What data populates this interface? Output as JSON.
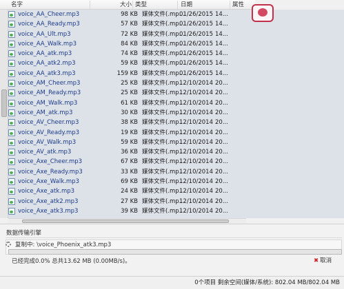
{
  "columns": {
    "name": "名字",
    "size": "大小",
    "type": "类型",
    "date": "日期",
    "attr": "属性"
  },
  "files": [
    {
      "name": "voice_AA_Cheer.mp3",
      "size": "98 KB",
      "type": "媒体文件(.mp...",
      "date": "01/26/2015",
      "ext": "14..."
    },
    {
      "name": "voice_AA_Ready.mp3",
      "size": "57 KB",
      "type": "媒体文件(.mp...",
      "date": "01/26/2015",
      "ext": "14..."
    },
    {
      "name": "voice_AA_Ult.mp3",
      "size": "72 KB",
      "type": "媒体文件(.mp...",
      "date": "01/26/2015",
      "ext": "14..."
    },
    {
      "name": "voice_AA_Walk.mp3",
      "size": "84 KB",
      "type": "媒体文件(.mp...",
      "date": "01/26/2015",
      "ext": "14..."
    },
    {
      "name": "voice_AA_atk.mp3",
      "size": "74 KB",
      "type": "媒体文件(.mp...",
      "date": "01/26/2015",
      "ext": "14..."
    },
    {
      "name": "voice_AA_atk2.mp3",
      "size": "59 KB",
      "type": "媒体文件(.mp...",
      "date": "01/26/2015",
      "ext": "14..."
    },
    {
      "name": "voice_AA_atk3.mp3",
      "size": "159 KB",
      "type": "媒体文件(.mp...",
      "date": "01/26/2015",
      "ext": "14..."
    },
    {
      "name": "voice_AM_Cheer.mp3",
      "size": "25 KB",
      "type": "媒体文件(.mp...",
      "date": "12/10/2014",
      "ext": "20..."
    },
    {
      "name": "voice_AM_Ready.mp3",
      "size": "25 KB",
      "type": "媒体文件(.mp...",
      "date": "12/10/2014",
      "ext": "20..."
    },
    {
      "name": "voice_AM_Walk.mp3",
      "size": "61 KB",
      "type": "媒体文件(.mp...",
      "date": "12/10/2014",
      "ext": "20..."
    },
    {
      "name": "voice_AM_atk.mp3",
      "size": "30 KB",
      "type": "媒体文件(.mp...",
      "date": "12/10/2014",
      "ext": "20..."
    },
    {
      "name": "voice_AV_Cheer.mp3",
      "size": "38 KB",
      "type": "媒体文件(.mp...",
      "date": "12/10/2014",
      "ext": "20..."
    },
    {
      "name": "voice_AV_Ready.mp3",
      "size": "19 KB",
      "type": "媒体文件(.mp...",
      "date": "12/10/2014",
      "ext": "20..."
    },
    {
      "name": "voice_AV_Walk.mp3",
      "size": "59 KB",
      "type": "媒体文件(.mp...",
      "date": "12/10/2014",
      "ext": "20..."
    },
    {
      "name": "voice_AV_atk.mp3",
      "size": "36 KB",
      "type": "媒体文件(.mp...",
      "date": "12/10/2014",
      "ext": "20..."
    },
    {
      "name": "voice_Axe_Cheer.mp3",
      "size": "67 KB",
      "type": "媒体文件(.mp...",
      "date": "12/10/2014",
      "ext": "20..."
    },
    {
      "name": "voice_Axe_Ready.mp3",
      "size": "33 KB",
      "type": "媒体文件(.mp...",
      "date": "12/10/2014",
      "ext": "20..."
    },
    {
      "name": "voice_Axe_Walk.mp3",
      "size": "69 KB",
      "type": "媒体文件(.mp...",
      "date": "12/10/2014",
      "ext": "20..."
    },
    {
      "name": "voice_Axe_atk.mp3",
      "size": "24 KB",
      "type": "媒体文件(.mp...",
      "date": "12/10/2014",
      "ext": "20..."
    },
    {
      "name": "voice_Axe_atk2.mp3",
      "size": "27 KB",
      "type": "媒体文件(.mp...",
      "date": "12/10/2014",
      "ext": "20..."
    },
    {
      "name": "voice_Axe_atk3.mp3",
      "size": "39 KB",
      "type": "媒体文件(.mp...",
      "date": "12/10/2014",
      "ext": "20..."
    }
  ],
  "transfer": {
    "section_label": "数据传输引擎",
    "copying_text": "复制中: \\voice_Phoenix_atk3.mp3",
    "progress_fraction": 0.0,
    "progress_text": "已经完成0.0% 总共13.62 MB (0.00MB/s)。",
    "cancel_label": "取消"
  },
  "status_bar": {
    "text": "0个项目   剩余空间(媒体/系统): 802.04 MB/802.04 MB"
  },
  "icons": {
    "file": "mp3-file-icon",
    "spinner": "busy-spinner-icon",
    "cancel": "close-icon"
  },
  "colors": {
    "progress_fill": "#4a9a3a",
    "cancel_x": "#cc2222",
    "list_bg": "#dde1e8"
  }
}
